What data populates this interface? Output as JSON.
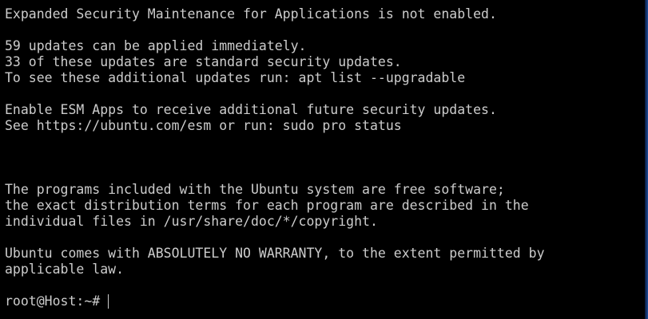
{
  "terminal": {
    "lines": [
      "Expanded Security Maintenance for Applications is not enabled.",
      "",
      "59 updates can be applied immediately.",
      "33 of these updates are standard security updates.",
      "To see these additional updates run: apt list --upgradable",
      "",
      "Enable ESM Apps to receive additional future security updates.",
      "See https://ubuntu.com/esm or run: sudo pro status",
      "",
      "",
      "",
      "The programs included with the Ubuntu system are free software;",
      "the exact distribution terms for each program are described in the",
      "individual files in /usr/share/doc/*/copyright.",
      "",
      "Ubuntu comes with ABSOLUTELY NO WARRANTY, to the extent permitted by",
      "applicable law.",
      ""
    ],
    "prompt": "root@Host:~#"
  },
  "colors": {
    "background": "#000000",
    "foreground": "#cccccc",
    "edge_accent": "#1e4f9e"
  }
}
